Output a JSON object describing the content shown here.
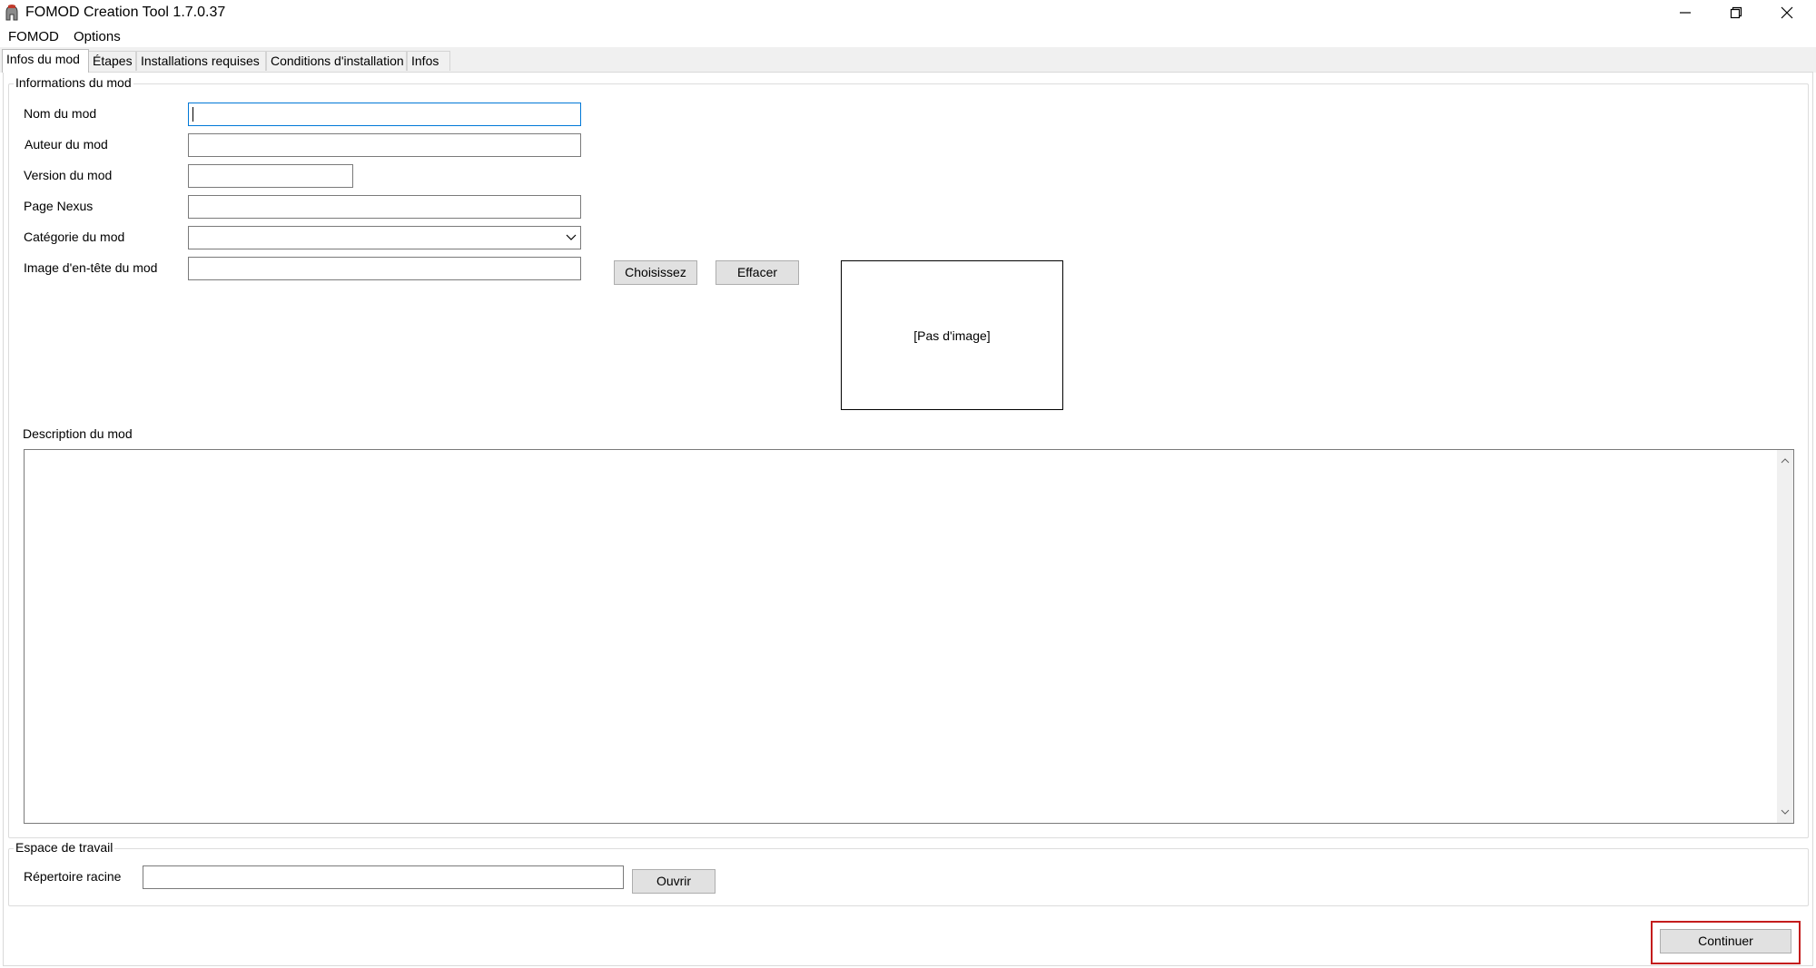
{
  "window": {
    "title": "FOMOD Creation Tool 1.7.0.37",
    "icon": "spartan-helmet-icon",
    "controls": [
      "minimize-icon",
      "restore-icon",
      "close-icon"
    ]
  },
  "menu": [
    "FOMOD",
    "Options"
  ],
  "tabs": [
    {
      "label": "Infos du mod",
      "active": true
    },
    {
      "label": "Étapes",
      "active": false
    },
    {
      "label": "Installations requises",
      "active": false
    },
    {
      "label": "Conditions d'installation",
      "active": false
    },
    {
      "label": "Infos",
      "active": false
    }
  ],
  "mod_info": {
    "legend": "Informations du mod",
    "name_label": "Nom du mod",
    "name_value": "",
    "author_label": "Auteur du mod",
    "author_value": "",
    "version_label": "Version du mod",
    "version_value": "",
    "nexus_label": "Page Nexus",
    "nexus_value": "",
    "category_label": "Catégorie du mod",
    "category_value": "",
    "header_image_label": "Image d'en-tête du mod",
    "header_image_value": "",
    "choose_button": "Choisissez",
    "clear_button": "Effacer",
    "image_placeholder": "[Pas d'image]",
    "description_label": "Description du mod",
    "description_value": ""
  },
  "workspace": {
    "legend": "Espace de travail",
    "root_label": "Répertoire racine",
    "root_value": "",
    "open_button": "Ouvrir"
  },
  "footer": {
    "continue_button": "Continuer",
    "highlight_color": "#c41c1c"
  }
}
